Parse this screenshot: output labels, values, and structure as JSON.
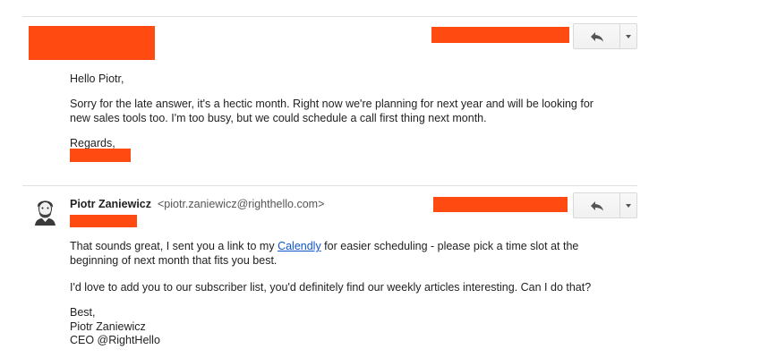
{
  "message1": {
    "greeting": "Hello Piotr,",
    "body_line1": "Sorry for the late answer, it's a hectic month. Right now we're planning for next year and will be looking for",
    "body_line2": "new sales tools too. I'm too busy, but we could schedule a call first thing next month.",
    "signoff": "Regards,"
  },
  "message2": {
    "sender_name": "Piotr Zaniewicz",
    "sender_email": "<piotr.zaniewicz@righthello.com>",
    "body1_before_link": "That sounds great, I sent you a link to my ",
    "link_text": "Calendly",
    "body1_after_link": " for easier scheduling - please pick a time slot at the",
    "body1_line2": "beginning of next month that fits you best.",
    "body2": "I'd love to add you to our subscriber list, you'd definitely find our weekly articles interesting. Can I do that?",
    "signoff": "Best,",
    "signature_name": "Piotr Zaniewicz",
    "signature_title": "CEO @RightHello"
  },
  "icons": {
    "reply": "reply-arrow-icon",
    "more": "chevron-down-icon"
  },
  "colors": {
    "redaction": "#ff4a12",
    "link": "#1155cc"
  }
}
